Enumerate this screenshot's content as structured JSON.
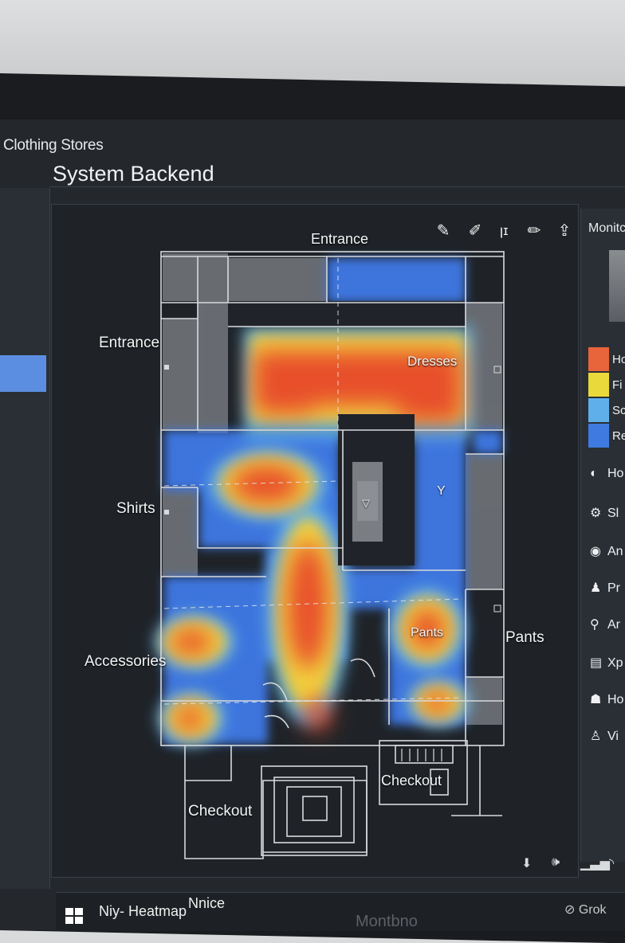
{
  "app": {
    "title": "Clothing Stores",
    "page_title": "System Backend"
  },
  "floorplan": {
    "labels": {
      "entrance_top": "Entrance",
      "entrance_left": "Entrance",
      "dresses": "Dresses",
      "shirts": "Shirts",
      "accessories": "Accessories",
      "pants_inner": "Pants",
      "pants_outer": "Pants",
      "checkout_left": "Checkout",
      "checkout_right": "Checkout",
      "marker": "Y"
    }
  },
  "toolbar": {
    "tools": [
      {
        "icon": "pen-icon",
        "glyph": "✎"
      },
      {
        "icon": "pencil-icon",
        "glyph": "✐"
      },
      {
        "icon": "text-tool-icon",
        "glyph": "ꞁɪ"
      },
      {
        "icon": "brush-icon",
        "glyph": "✏"
      },
      {
        "icon": "share-icon",
        "glyph": "⇪"
      }
    ]
  },
  "right_panel": {
    "header": "Monitc",
    "legend": [
      {
        "label": "Ho",
        "color": "#e8643a"
      },
      {
        "label": "Fi",
        "color": "#e9d93a"
      },
      {
        "label": "Sc",
        "color": "#5fb0ea"
      },
      {
        "label": "Re",
        "color": "#3f7ae0"
      }
    ],
    "items": [
      {
        "label": "Ho",
        "icon": "mic-icon",
        "glyph": "◐"
      },
      {
        "label": "Sl",
        "icon": "gear-icon",
        "glyph": "⚙"
      },
      {
        "label": "An",
        "icon": "eye-icon",
        "glyph": "◉"
      },
      {
        "label": "Pr",
        "icon": "person-icon",
        "glyph": "♟"
      },
      {
        "label": "Ar",
        "icon": "search-icon",
        "glyph": "⚲"
      },
      {
        "label": "Xp",
        "icon": "window-icon",
        "glyph": "▤"
      },
      {
        "label": "Ho",
        "icon": "home-icon",
        "glyph": "☗"
      },
      {
        "label": "Vi",
        "icon": "visitor-icon",
        "glyph": "♙"
      }
    ]
  },
  "taskbar": {
    "items": [
      "Niy- Heatmap",
      "Nnice"
    ]
  },
  "tray": {
    "icons": [
      "download-icon",
      "volume-icon",
      "signal-icon",
      "wifi-icon"
    ]
  },
  "monitor": {
    "brand": "Montbno"
  },
  "watermark": {
    "text": "Grok"
  },
  "colors": {
    "hot": "#e8502a",
    "warm": "#f0c53a",
    "cool": "#5aa8ea",
    "cold": "#3f73dd",
    "panel": "#24282d",
    "wall": "#6e7176"
  }
}
